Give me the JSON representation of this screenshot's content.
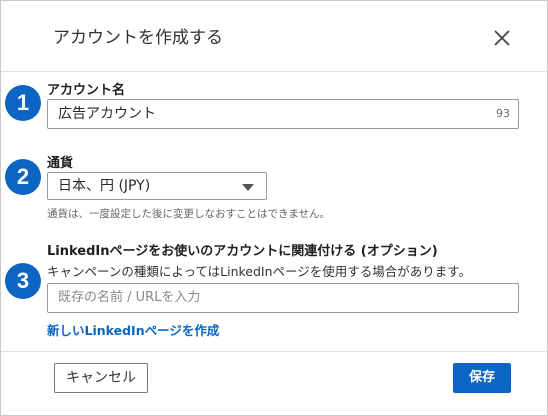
{
  "dialog": {
    "title": "アカウントを作成する",
    "close_icon": "close-icon"
  },
  "steps": [
    "1",
    "2",
    "3"
  ],
  "account_name": {
    "label": "アカウント名",
    "value": "広告アカウント",
    "counter": "93"
  },
  "currency": {
    "label": "通貨",
    "selected": "日本、円 (JPY)",
    "helper": "通貨は、一度設定した後に変更しなおすことはできません。"
  },
  "linkedin_page": {
    "label": "LinkedInページをお使いのアカウントに関連付ける (オプション)",
    "description": "キャンペーンの種類によってはLinkedInページを使用する場合があります。",
    "placeholder": "既存の名前 / URLを入力",
    "create_link": "新しいLinkedInページを作成"
  },
  "footer": {
    "cancel_label": "キャンセル",
    "save_label": "保存"
  },
  "colors": {
    "accent": "#0a66c2",
    "badge": "#0a66c2"
  }
}
